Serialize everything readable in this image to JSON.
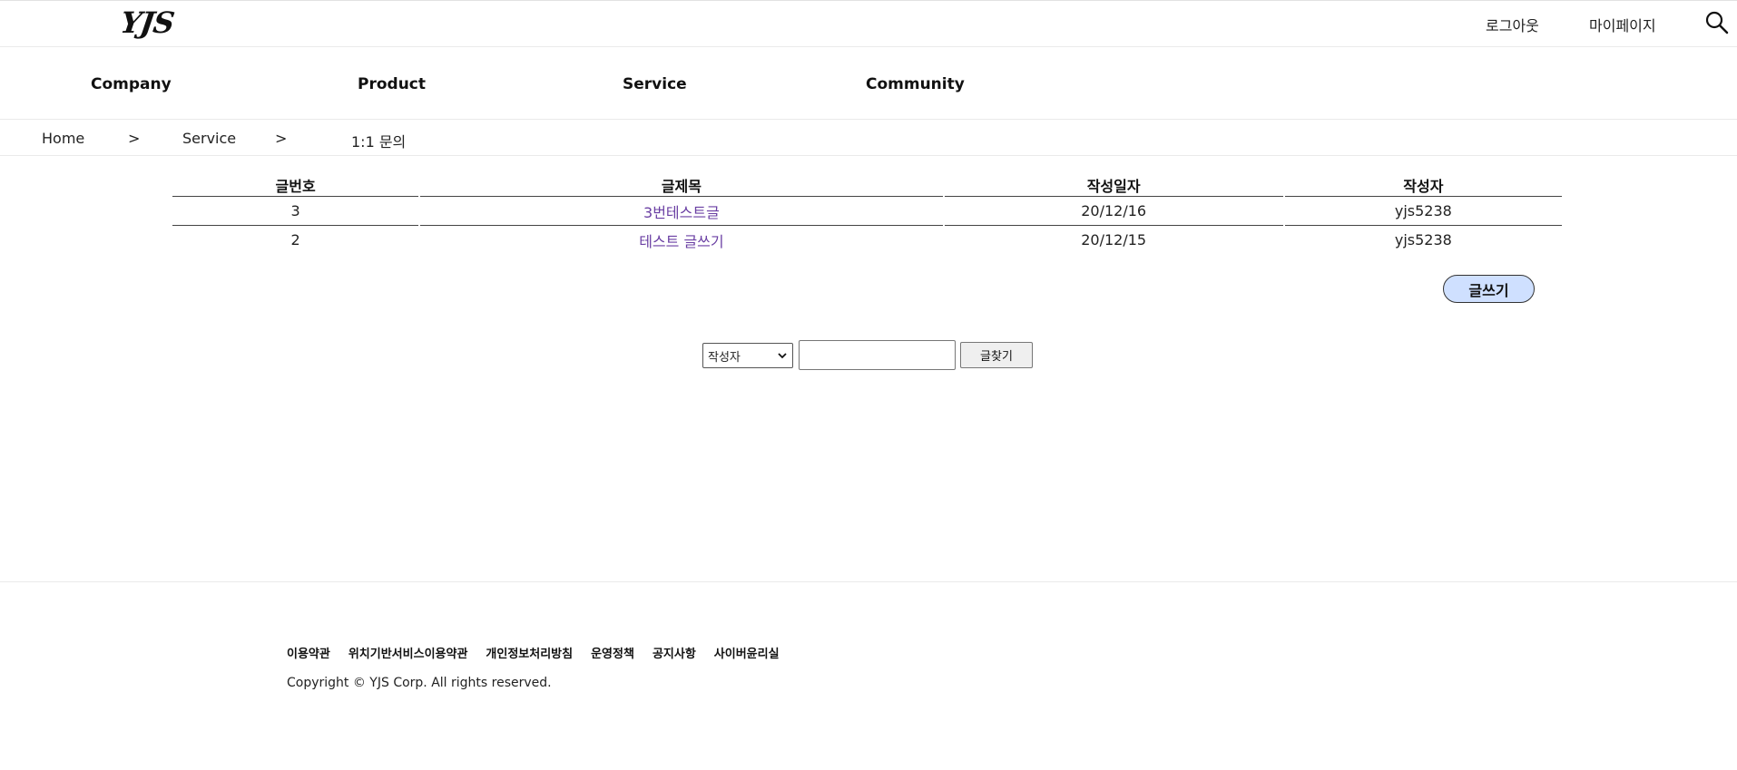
{
  "header": {
    "logo": "YJS",
    "logout_label": "로그아웃",
    "mypage_label": "마이페이지",
    "search_icon": "search-icon"
  },
  "nav": {
    "items": [
      "Company",
      "Product",
      "Service",
      "Community"
    ]
  },
  "breadcrumb": {
    "home": "Home",
    "sep1": ">",
    "section": "Service",
    "sep2": ">",
    "current": "1:1 문의"
  },
  "board": {
    "headers": [
      "글번호",
      "글제목",
      "작성일자",
      "작성자"
    ],
    "rows": [
      {
        "no": "3",
        "title": "3번테스트글",
        "date": "20/12/16",
        "author": "yjs5238"
      },
      {
        "no": "2",
        "title": "테스트 글쓰기",
        "date": "20/12/15",
        "author": "yjs5238"
      }
    ],
    "write_label": "글쓰기"
  },
  "search": {
    "selected_option": "작성자",
    "input_value": "",
    "find_label": "글찾기"
  },
  "footer": {
    "links": [
      "이용약관",
      "위치기반서비스이용약관",
      "개인정보처리방침",
      "운영정책",
      "공지사항",
      "사이버윤리실"
    ],
    "copyright": "Copyright © YJS Corp. All rights reserved."
  },
  "colors": {
    "link": "#6a3fa3",
    "write_button_bg": "#cfe0ff"
  }
}
